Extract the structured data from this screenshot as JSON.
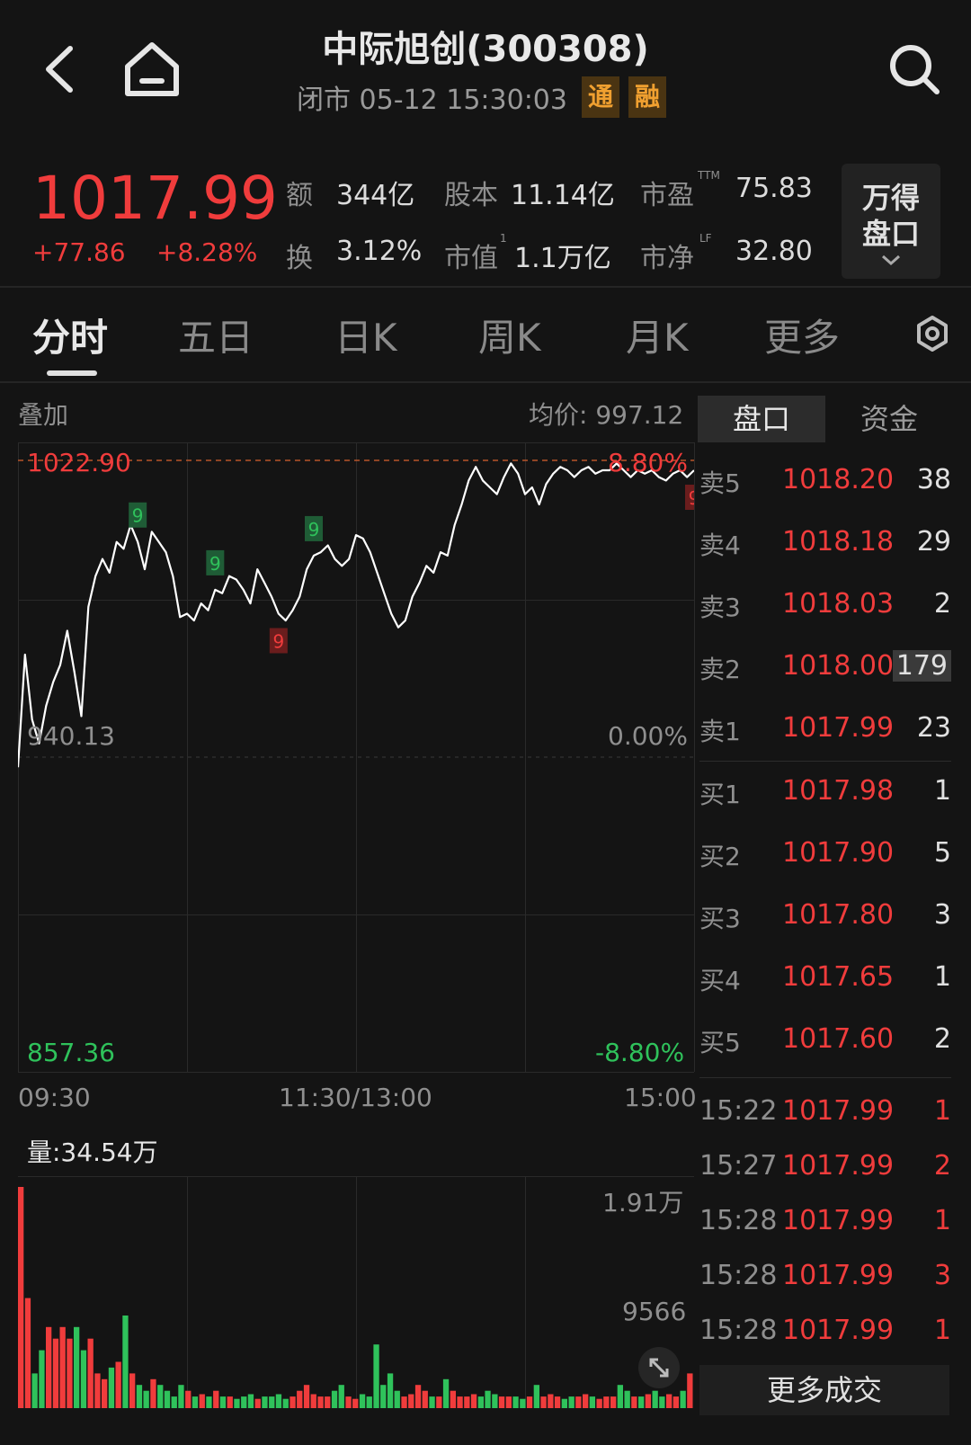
{
  "header": {
    "title": "中际旭创(300308)",
    "status": "闭市 05-12 15:30:03",
    "tags": [
      "通",
      "融"
    ]
  },
  "quote": {
    "price": "1017.99",
    "change": "+77.86",
    "change_pct": "+8.28%",
    "stats": [
      {
        "label": "额",
        "value": "344亿"
      },
      {
        "label": "股本",
        "value": "11.14亿"
      },
      {
        "label": "市盈",
        "sup": "TTM",
        "value": "75.83"
      },
      {
        "label": "换",
        "value": "3.12%"
      },
      {
        "label": "市值",
        "sup": "1",
        "value": "1.1万亿"
      },
      {
        "label": "市净",
        "sup": "LF",
        "value": "32.80"
      }
    ],
    "wind_button": [
      "万得",
      "盘口"
    ]
  },
  "tabs": [
    "分时",
    "五日",
    "日K",
    "周K",
    "月K",
    "更多"
  ],
  "chart": {
    "overlay_label": "叠加",
    "avg_price": "均价: 997.12",
    "price_high": "1022.90",
    "pct_high": "8.80%",
    "price_mid": "940.13",
    "pct_mid": "0.00%",
    "price_low": "857.36",
    "pct_low": "-8.80%",
    "time_labels": [
      "09:30",
      "11:30/13:00",
      "15:00"
    ],
    "markers": [
      "9",
      "9",
      "9",
      "9",
      "9"
    ],
    "volume_label": "量:34.54万",
    "vol_high": "1.91万",
    "vol_mid": "9566",
    "colors": {
      "up": "#f03c3c",
      "down": "#2fc25b",
      "line": "#ffffff"
    }
  },
  "chart_data": {
    "type": "line",
    "series": [
      {
        "values": [
          933,
          966,
          947,
          940,
          951,
          958,
          963,
          973,
          961,
          948,
          980,
          989,
          994,
          990,
          999,
          997,
          1004,
          999,
          991,
          1002,
          999,
          996,
          989,
          977,
          978,
          976,
          981,
          979,
          985,
          984,
          989,
          988,
          985,
          981,
          991,
          987,
          983,
          978,
          976,
          979,
          983,
          991,
          995,
          996,
          998,
          994,
          992,
          994,
          1001,
          1000,
          996,
          990,
          984,
          978,
          974,
          976,
          983,
          987,
          992,
          990,
          996,
          995,
          1004,
          1010,
          1017,
          1021,
          1017,
          1015,
          1013,
          1018,
          1022,
          1019,
          1013,
          1015,
          1010,
          1016,
          1019,
          1021,
          1020,
          1018,
          1020,
          1021,
          1019,
          1020,
          1020,
          1022,
          1020,
          1018,
          1020,
          1019,
          1020,
          1018,
          1017,
          1019,
          1020,
          1018,
          1020
        ]
      }
    ],
    "ylim": [
      857.36,
      1022.9
    ],
    "volume_10k": [
      1.91,
      0.95,
      0.3,
      0.5,
      0.7,
      0.6,
      0.7,
      0.6,
      0.7,
      0.5,
      0.6,
      0.3,
      0.25,
      0.35,
      0.4,
      0.8,
      0.3,
      0.2,
      0.15,
      0.25,
      0.2,
      0.15,
      0.1,
      0.2,
      0.15,
      0.1,
      0.12,
      0.1,
      0.15,
      0.1,
      0.1,
      0.08,
      0.1,
      0.12,
      0.08,
      0.1,
      0.1,
      0.12,
      0.08,
      0.1,
      0.15,
      0.2,
      0.12,
      0.1,
      0.1,
      0.15,
      0.2,
      0.1,
      0.08,
      0.12,
      0.1,
      0.55,
      0.2,
      0.3,
      0.15,
      0.1,
      0.12,
      0.2,
      0.15,
      0.1,
      0.1,
      0.25,
      0.15,
      0.1,
      0.1,
      0.12,
      0.1,
      0.15,
      0.12,
      0.1,
      0.1,
      0.1,
      0.08,
      0.1,
      0.2,
      0.1,
      0.12,
      0.1,
      0.08,
      0.1,
      0.1,
      0.12,
      0.1,
      0.08,
      0.1,
      0.1,
      0.2,
      0.15,
      0.1,
      0.1,
      0.12,
      0.15,
      0.1,
      0.12,
      0.1,
      0.15,
      0.3
    ]
  },
  "side_tabs": [
    "盘口",
    "资金"
  ],
  "order_book": {
    "asks": [
      {
        "label": "卖5",
        "price": "1018.20",
        "qty": "38"
      },
      {
        "label": "卖4",
        "price": "1018.18",
        "qty": "29"
      },
      {
        "label": "卖3",
        "price": "1018.03",
        "qty": "2"
      },
      {
        "label": "卖2",
        "price": "1018.00",
        "qty": "179"
      },
      {
        "label": "卖1",
        "price": "1017.99",
        "qty": "23"
      }
    ],
    "bids": [
      {
        "label": "买1",
        "price": "1017.98",
        "qty": "1"
      },
      {
        "label": "买2",
        "price": "1017.90",
        "qty": "5"
      },
      {
        "label": "买3",
        "price": "1017.80",
        "qty": "3"
      },
      {
        "label": "买4",
        "price": "1017.65",
        "qty": "1"
      },
      {
        "label": "买5",
        "price": "1017.60",
        "qty": "2"
      }
    ]
  },
  "trades": [
    {
      "time": "15:22",
      "price": "1017.99",
      "qty": "1"
    },
    {
      "time": "15:27",
      "price": "1017.99",
      "qty": "2"
    },
    {
      "time": "15:28",
      "price": "1017.99",
      "qty": "1"
    },
    {
      "time": "15:28",
      "price": "1017.99",
      "qty": "3"
    },
    {
      "time": "15:28",
      "price": "1017.99",
      "qty": "1"
    }
  ],
  "more_trades_label": "更多成交"
}
